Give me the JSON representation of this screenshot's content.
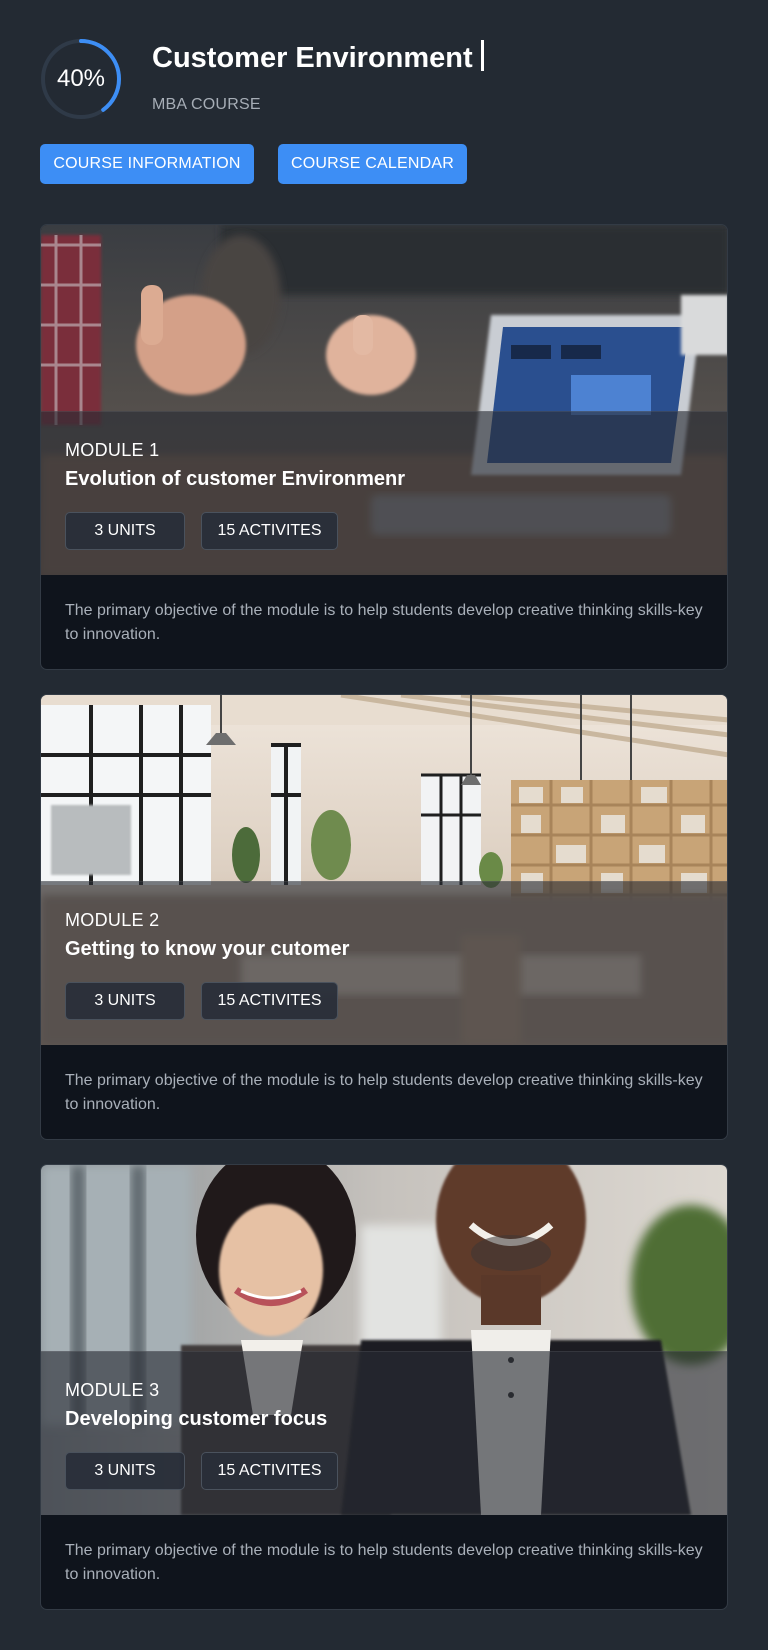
{
  "header": {
    "progress_label": "40%",
    "progress_value": 0.4,
    "title": "Customer Environment",
    "subtitle": "MBA COURSE"
  },
  "actions": {
    "course_information": "COURSE INFORMATION",
    "course_calendar": "COURSE CALENDAR"
  },
  "colors": {
    "background": "#232a33",
    "accent": "#3d8ef5",
    "card_body": "#0f141c"
  },
  "modules": [
    {
      "label": "MODULE 1",
      "title": "Evolution of customer Environmenr",
      "units": "3 UNITS",
      "activities": "15 ACTIVITES",
      "description": "The primary objective of the module is to help students develop creative thinking skills-key to innovation.",
      "image": "meeting-hands-laptop-photo"
    },
    {
      "label": "MODULE 2",
      "title": "Getting to know your cutomer",
      "units": "3 UNITS",
      "activities": "15 ACTIVITES",
      "description": "The primary objective of the module is to help students develop creative thinking skills-key to innovation.",
      "image": "bright-office-interior-photo"
    },
    {
      "label": "MODULE 3",
      "title": "Developing customer focus",
      "units": "3 UNITS",
      "activities": "15 ACTIVITES",
      "description": "The primary objective of the module is to help students develop creative thinking skills-key to innovation.",
      "image": "smiling-colleagues-photo"
    }
  ]
}
